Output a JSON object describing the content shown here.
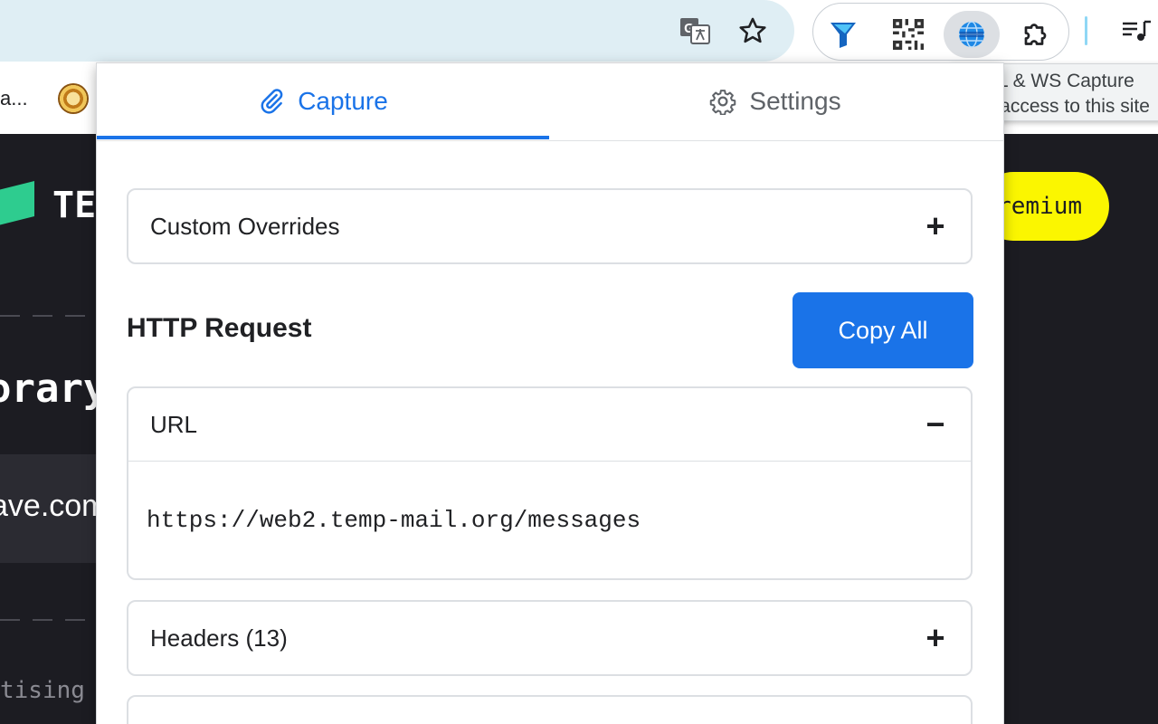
{
  "browser": {
    "bookmark_label": "a...",
    "tooltip": {
      "line1": "cURL & WS Capture",
      "line2": "Has access to this site"
    }
  },
  "background_site": {
    "logo_text": "TE",
    "heading": "orary",
    "box_text": "ave.com",
    "footer_text": "tising",
    "premium_label": "remium"
  },
  "popup": {
    "tabs": [
      {
        "label": "Capture",
        "active": true,
        "icon": "paperclip-icon"
      },
      {
        "label": "Settings",
        "active": false,
        "icon": "gear-icon"
      }
    ],
    "custom_overrides": {
      "label": "Custom Overrides",
      "toggle": "+"
    },
    "http_request": {
      "title": "HTTP Request",
      "copy_all_label": "Copy All"
    },
    "url_section": {
      "label": "URL",
      "toggle": "−",
      "value": "https://web2.temp-mail.org/messages"
    },
    "headers_section": {
      "label": "Headers (13)",
      "toggle": "+"
    }
  },
  "colors": {
    "accent": "#1a73e8",
    "premium": "#fbf600",
    "site_bg": "#1c1c22"
  }
}
